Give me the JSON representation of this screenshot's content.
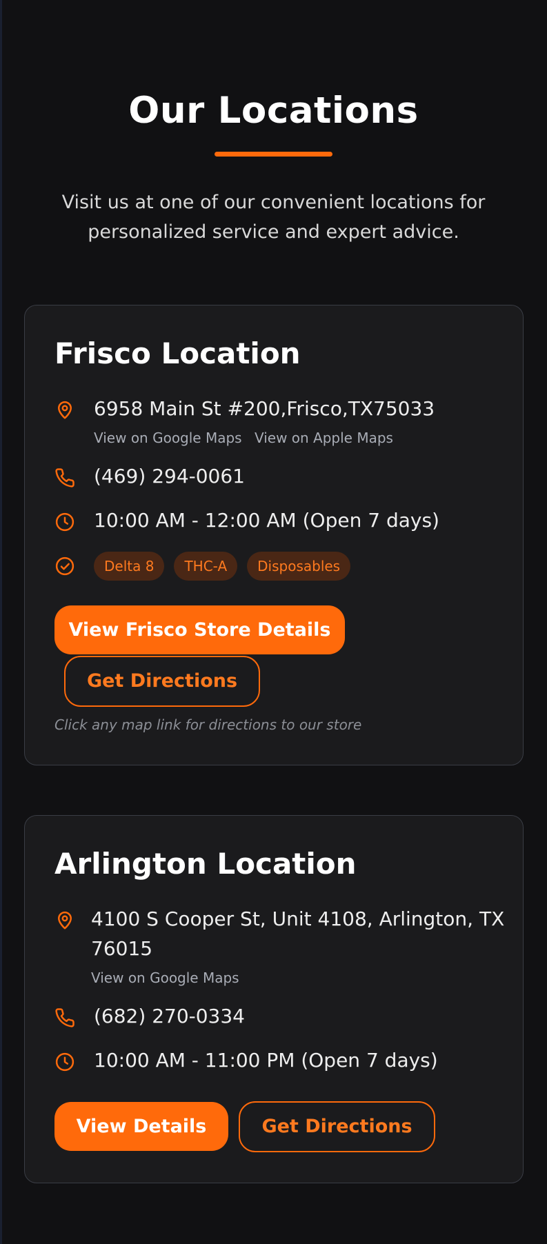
{
  "section": {
    "title": "Our Locations",
    "intro": "Visit us at one of our convenient locations for personalized service and expert advice."
  },
  "colors": {
    "accent": "#ff6a0b",
    "card_bg": "#1b1b1d",
    "page_bg": "#111113",
    "tag_bg": "#4a2715"
  },
  "frisco": {
    "title": "Frisco Location",
    "address": "6958 Main St #200,Frisco,TX75033",
    "google_maps": "View on Google Maps",
    "apple_maps": "View on Apple Maps",
    "phone": "(469) 294-0061",
    "hours": "10:00 AM - 12:00 AM (Open 7 days)",
    "tags": [
      "Delta 8",
      "THC-A",
      "Disposables"
    ],
    "details_button": "View Frisco Store Details",
    "directions_button": "Get Directions",
    "note": "Click any map link for directions to our store"
  },
  "arlington": {
    "title": "Arlington Location",
    "address_line1": "4100 S Cooper St, Unit 4108, Arlington, TX",
    "address_line2": "76015",
    "google_maps": "View on Google Maps",
    "phone": "(682) 270-0334",
    "hours": "10:00 AM - 11:00 PM (Open 7 days)",
    "details_button": "View Details",
    "directions_button": "Get Directions"
  },
  "icons": {
    "location": "map-pin-icon",
    "phone": "phone-icon",
    "hours": "clock-icon",
    "products": "check-circle-icon"
  }
}
